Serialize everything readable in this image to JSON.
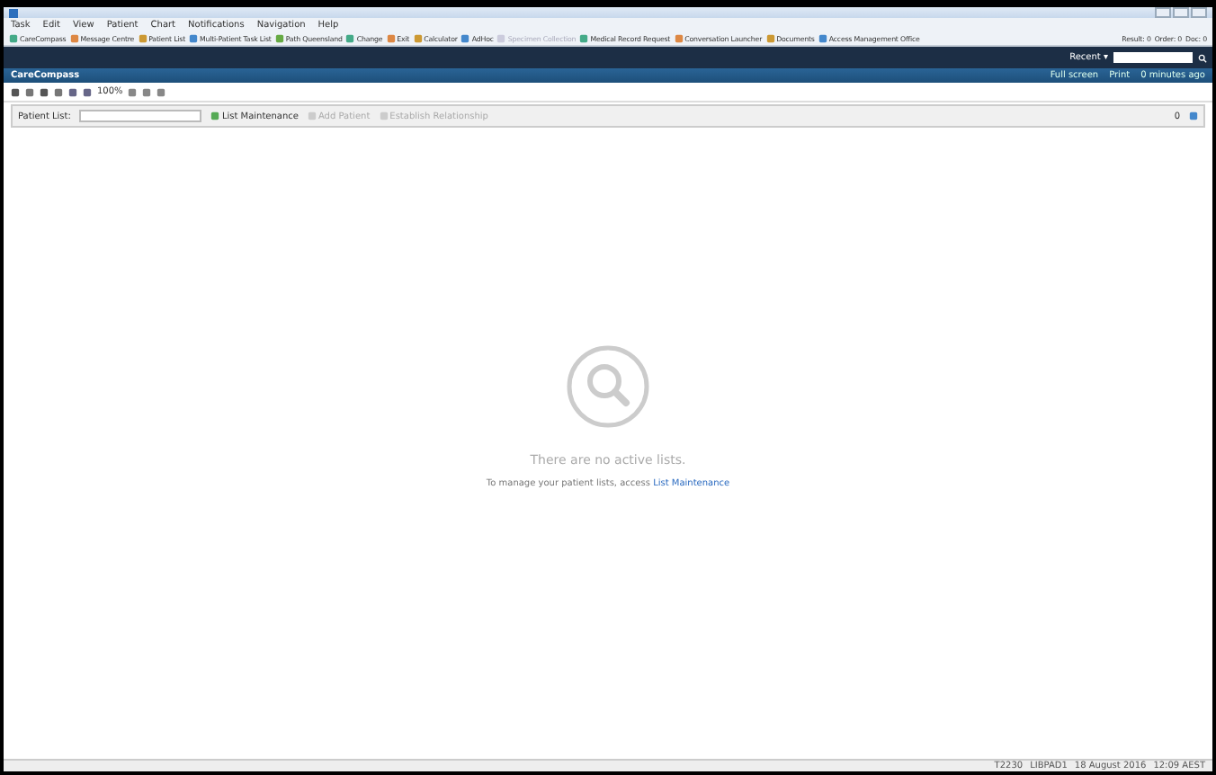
{
  "menu": [
    "Task",
    "Edit",
    "View",
    "Patient",
    "Chart",
    "Notifications",
    "Navigation",
    "Help"
  ],
  "toolbar": [
    {
      "label": "CareCompass",
      "disabled": false
    },
    {
      "label": "Message Centre",
      "disabled": false
    },
    {
      "label": "Patient List",
      "disabled": false
    },
    {
      "label": "Multi-Patient Task List",
      "disabled": false
    },
    {
      "label": "Path Queensland",
      "disabled": false
    },
    {
      "label": "Change",
      "disabled": false
    },
    {
      "label": "Exit",
      "disabled": false
    },
    {
      "label": "Calculator",
      "disabled": false
    },
    {
      "label": "AdHoc",
      "disabled": false
    },
    {
      "label": "Specimen Collection",
      "disabled": true
    },
    {
      "label": "Medical Record Request",
      "disabled": false
    },
    {
      "label": "Conversation Launcher",
      "disabled": false
    },
    {
      "label": "Documents",
      "disabled": false
    },
    {
      "label": "Access Management Office",
      "disabled": false
    }
  ],
  "counters": [
    "Result: 0",
    "Order: 0",
    "Doc: 0"
  ],
  "recent": "Recent ▾",
  "page_title": "CareCompass",
  "page_actions": [
    "Full screen",
    "Print",
    "0 minutes ago"
  ],
  "zoom": "100%",
  "patient_list": {
    "label": "Patient List:",
    "actions": [
      {
        "label": "List Maintenance",
        "disabled": false
      },
      {
        "label": "Add Patient",
        "disabled": true
      },
      {
        "label": "Establish Relationship",
        "disabled": true
      }
    ],
    "count": "0"
  },
  "empty": {
    "title": "There are no active lists.",
    "text": "To manage your patient lists, access",
    "link": "List Maintenance"
  },
  "status_bar": [
    "T2230",
    "LIBPAD1",
    "18 August 2016",
    "12:09 AEST"
  ]
}
